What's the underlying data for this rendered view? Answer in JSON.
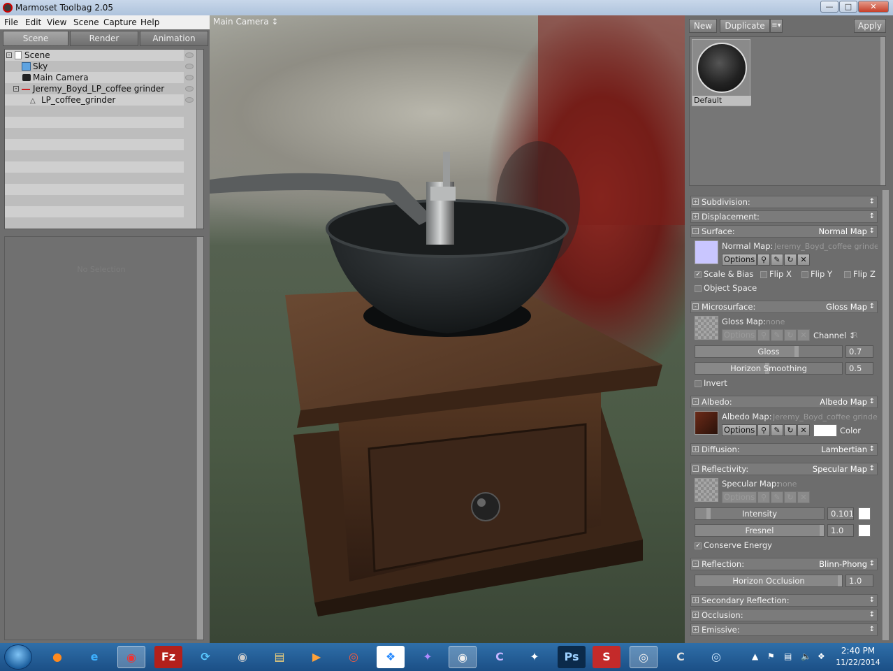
{
  "window": {
    "title": "Marmoset Toolbag 2.05",
    "minimize": "—",
    "maximize": "□",
    "close": "✕"
  },
  "menu": [
    "File",
    "Edit",
    "View",
    "Scene",
    "Capture",
    "Help"
  ],
  "tabs": [
    "Scene",
    "Render",
    "Animation"
  ],
  "scene_tree": [
    {
      "label": "Scene",
      "icon": "scene-icon"
    },
    {
      "label": "Sky",
      "icon": "sky-icon"
    },
    {
      "label": "Main Camera",
      "icon": "camera-icon"
    },
    {
      "label": "Jeremy_Boyd_LP_coffee grinder",
      "icon": "mesh-group-icon"
    },
    {
      "label": "LP_coffee_grinder",
      "icon": "mesh-icon"
    }
  ],
  "properties": {
    "empty_text": "No Selection"
  },
  "viewport": {
    "camera_label": "Main Camera ↕"
  },
  "material_toolbar": {
    "new": "New",
    "duplicate": "Duplicate",
    "menu": "≡▾",
    "apply": "Apply"
  },
  "materials": [
    {
      "name": "Default"
    }
  ],
  "sections": {
    "subdivision": {
      "label": "Subdivision:",
      "value": ""
    },
    "displacement": {
      "label": "Displacement:",
      "value": ""
    },
    "surface": {
      "label": "Surface:",
      "value": "Normal Map"
    },
    "microsurface": {
      "label": "Microsurface:",
      "value": "Gloss Map"
    },
    "albedo": {
      "label": "Albedo:",
      "value": "Albedo Map"
    },
    "diffusion": {
      "label": "Diffusion:",
      "value": "Lambertian"
    },
    "reflectivity": {
      "label": "Reflectivity:",
      "value": "Specular Map"
    },
    "reflection": {
      "label": "Reflection:",
      "value": "Blinn-Phong"
    },
    "secondary_reflection": {
      "label": "Secondary Reflection:",
      "value": ""
    },
    "occlusion": {
      "label": "Occlusion:",
      "value": ""
    },
    "emissive": {
      "label": "Emissive:",
      "value": ""
    }
  },
  "surface": {
    "map_label": "Normal Map:",
    "map_file": "Jeremy_Boyd_coffee grinder",
    "options": "Options",
    "scale_bias": {
      "label": "Scale & Bias",
      "checked": true
    },
    "flip_x": {
      "label": "Flip X",
      "checked": false
    },
    "flip_y": {
      "label": "Flip Y",
      "checked": false
    },
    "flip_z": {
      "label": "Flip Z",
      "checked": false
    },
    "object_space": {
      "label": "Object Space",
      "checked": false
    }
  },
  "microsurface": {
    "map_label": "Gloss Map:",
    "map_file": "none",
    "options": "Options",
    "channel_label": "Channel ↕",
    "channel_value": "R",
    "gloss": {
      "label": "Gloss",
      "value": "0.7",
      "fraction": 0.7
    },
    "horizon_smoothing": {
      "label": "Horizon Smoothing",
      "value": "0.5",
      "fraction": 0.5
    },
    "invert": {
      "label": "Invert",
      "checked": false
    }
  },
  "albedo": {
    "map_label": "Albedo Map:",
    "map_file": "Jeremy_Boyd_coffee grinder",
    "options": "Options",
    "color_label": "Color"
  },
  "reflectivity": {
    "map_label": "Specular Map:",
    "map_file": "none",
    "options": "Options",
    "intensity": {
      "label": "Intensity",
      "value": "0.101",
      "fraction": 0.1
    },
    "fresnel": {
      "label": "Fresnel",
      "value": "1.0",
      "fraction": 1.0
    },
    "conserve_energy": {
      "label": "Conserve Energy",
      "checked": true
    }
  },
  "reflection": {
    "horizon_occlusion": {
      "label": "Horizon Occlusion",
      "value": "1.0",
      "fraction": 1.0
    }
  },
  "taskbar": {
    "apps": [
      "firefox-icon",
      "ie-icon",
      "chrome-icon",
      "filezilla-icon",
      "app-icon",
      "marmoset-alt-icon",
      "explorer-icon",
      "media-icon",
      "ccleaner-icon",
      "dropbox-icon",
      "app-purple-icon",
      "marmoset-icon",
      "app-blue-icon",
      "zbrush-icon",
      "photoshop-icon",
      "substance-icon",
      "app-gray-icon",
      "app-c-icon",
      "app-ring-icon"
    ],
    "time": "2:40 PM",
    "date": "11/22/2014"
  }
}
